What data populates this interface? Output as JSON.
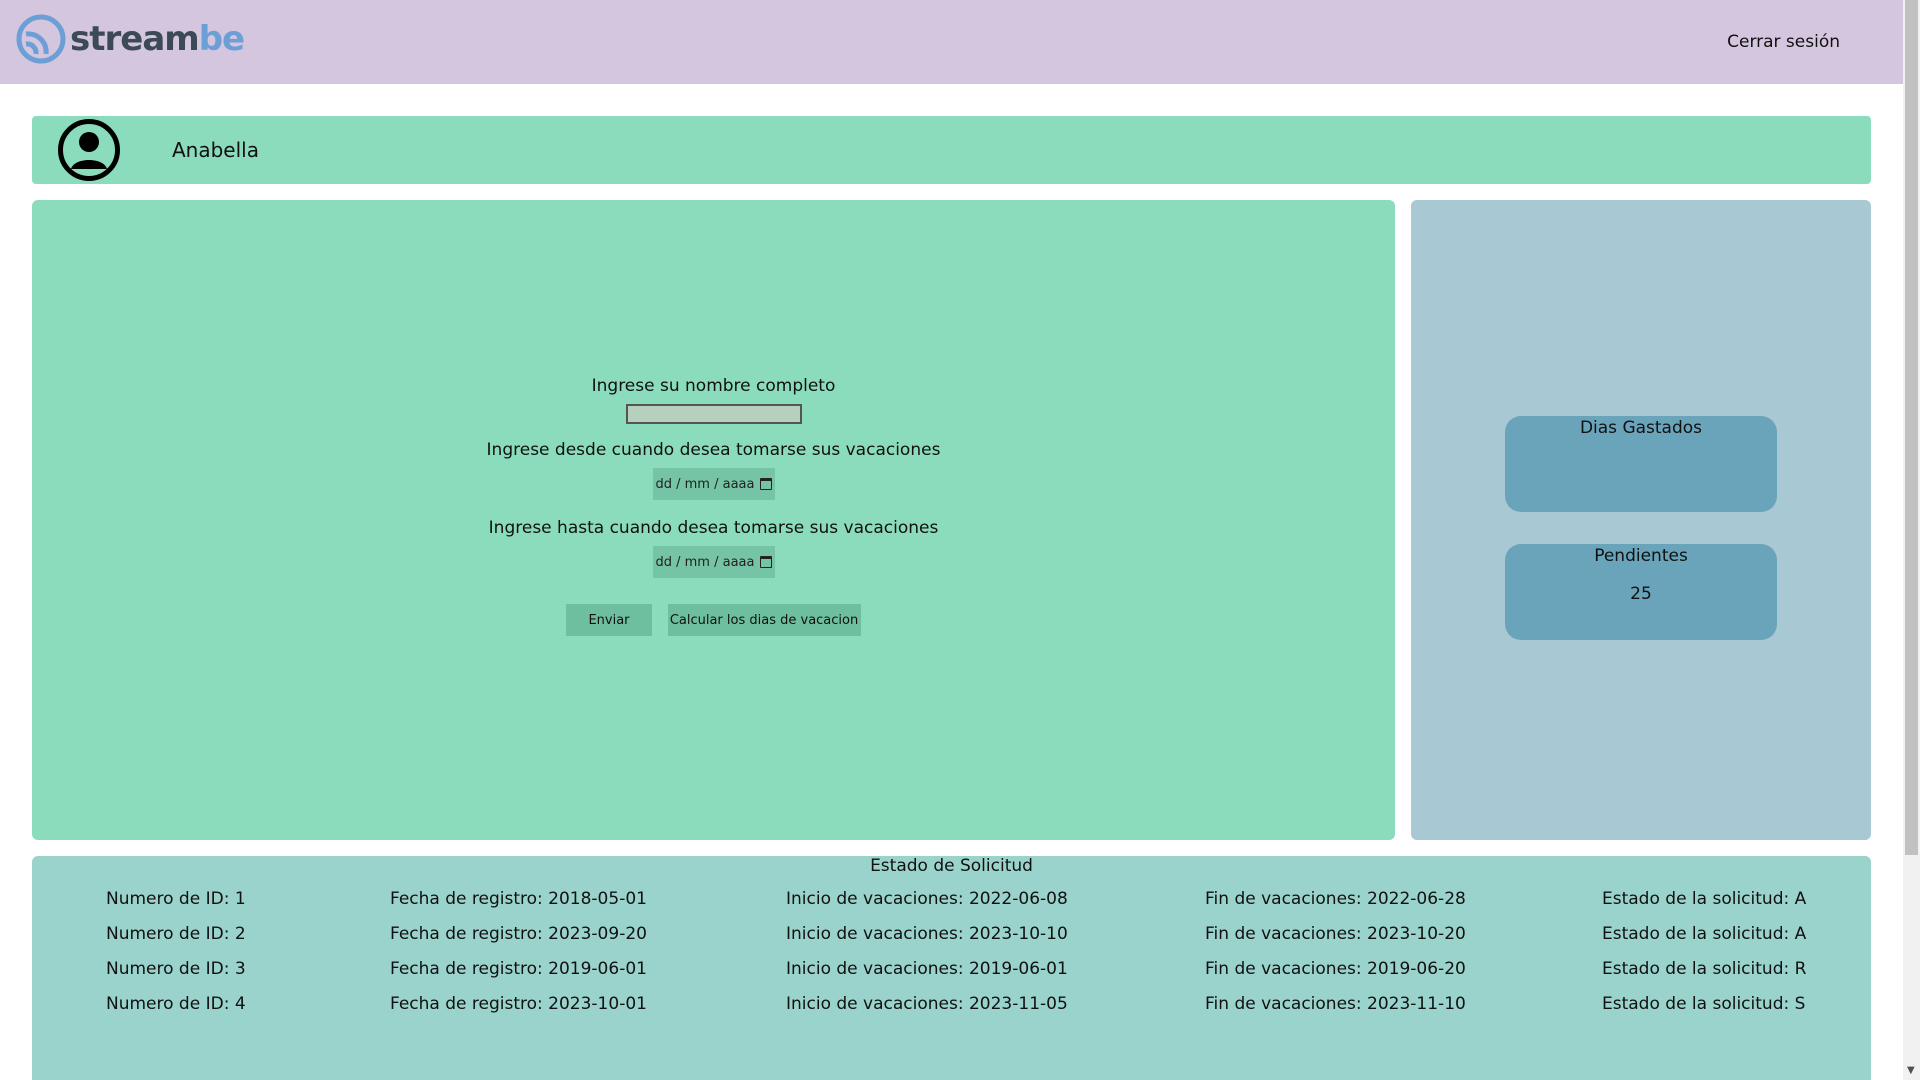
{
  "header": {
    "logo_text_stream": "stream",
    "logo_text_be": "be",
    "logout_label": "Cerrar sesión"
  },
  "page_load_progress": 0.2,
  "profile": {
    "name": "Anabella"
  },
  "form": {
    "name_label": "Ingrese su nombre completo",
    "name_value": "",
    "from_label": "Ingrese desde cuando desea tomarse sus vacaciones",
    "from_placeholder": "dd / mm / aaaa",
    "to_label": "Ingrese hasta cuando desea tomarse sus vacaciones",
    "to_placeholder": "dd / mm / aaaa",
    "submit_label": "Enviar",
    "calculate_label": "Calcular los dias de vacacion"
  },
  "stats": {
    "spent_title": "Dias Gastados",
    "spent_value": "",
    "pending_title": "Pendientes",
    "pending_value": "25"
  },
  "status": {
    "title": "Estado de Solicitud",
    "rows": [
      {
        "id": "Numero de ID: 1",
        "registered": "Fecha de registro: 2018-05-01",
        "start": "Inicio de vacaciones: 2022-06-08",
        "end": "Fin de vacaciones: 2022-06-28",
        "state": "Estado de la solicitud: A"
      },
      {
        "id": "Numero de ID: 2",
        "registered": "Fecha de registro: 2023-09-20",
        "start": "Inicio de vacaciones: 2023-10-10",
        "end": "Fin de vacaciones: 2023-10-20",
        "state": "Estado de la solicitud: A"
      },
      {
        "id": "Numero de ID: 3",
        "registered": "Fecha de registro: 2019-06-01",
        "start": "Inicio de vacaciones: 2019-06-01",
        "end": "Fin de vacaciones: 2019-06-20",
        "state": "Estado de la solicitud: R"
      },
      {
        "id": "Numero de ID: 4",
        "registered": "Fecha de registro: 2023-10-01",
        "start": "Inicio de vacaciones: 2023-11-05",
        "end": "Fin de vacaciones: 2023-11-10",
        "state": "Estado de la solicitud: S"
      }
    ]
  },
  "colors": {
    "header_bg": "#d5c6e0",
    "panel_green": "#8adcbc",
    "panel_blue": "#a8c8d4",
    "card_blue": "#6aa4ba",
    "status_bg": "#9ad3cb",
    "logo_blue": "#6c9fd6"
  },
  "icons": {
    "logo": "streambe-logo-icon",
    "avatar": "user-avatar-icon",
    "calendar": "calendar-icon"
  }
}
